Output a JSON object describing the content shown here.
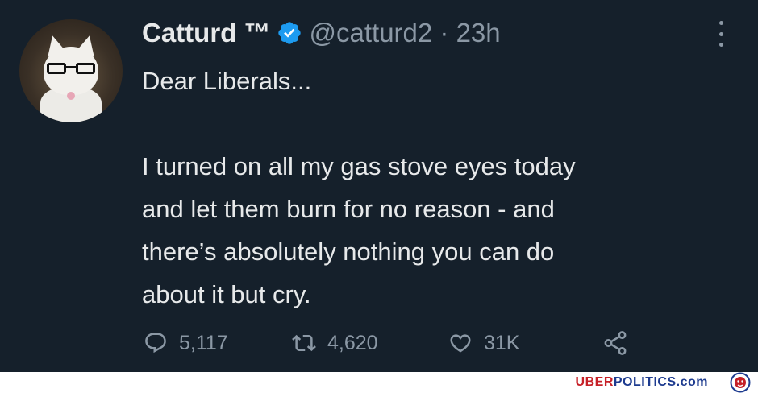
{
  "tweet": {
    "display_name": "Catturd ™",
    "handle": "@catturd2 · 23h",
    "text": "Dear Liberals...\n\nI turned on all my gas stove eyes today\nand let them burn for no reason - and\nthere’s absolutely nothing you can do\nabout it but cry.",
    "replies": "5,117",
    "retweets": "4,620",
    "likes": "31K"
  },
  "footer": {
    "brand_part1": "UBER",
    "brand_part2": "POLITICS",
    "brand_part3": ".com"
  },
  "colors": {
    "background": "#15202b",
    "text": "#e7e9ea",
    "secondary": "#8b98a5",
    "verified": "#1d9bf0",
    "brand_red": "#c62027",
    "brand_blue": "#1d3b8f"
  },
  "icons": [
    "verified-badge-icon",
    "more-options-icon",
    "reply-icon",
    "retweet-icon",
    "like-icon",
    "share-icon",
    "lion-logo-icon"
  ]
}
